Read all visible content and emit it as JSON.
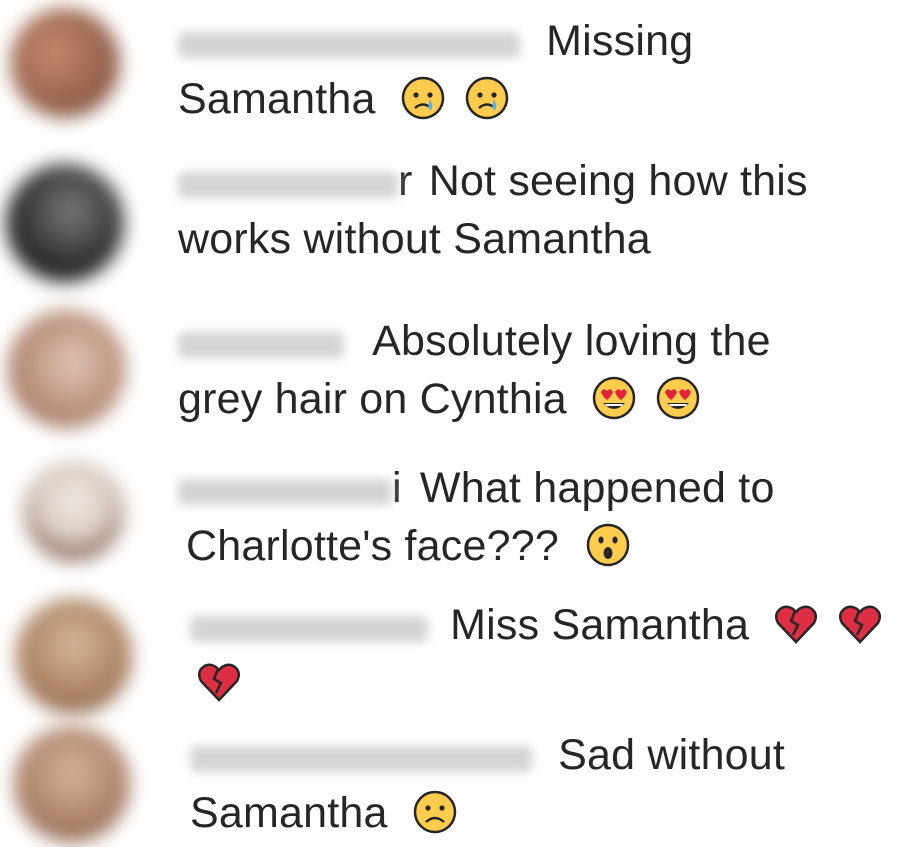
{
  "comments": [
    {
      "username_tail": "",
      "line1": "Missing",
      "line2": "Samantha",
      "emojis_line2": [
        "crying-face",
        "crying-face"
      ],
      "avatar_colors": [
        "#b07a60",
        "#8c5a45"
      ]
    },
    {
      "username_tail": "r",
      "line1": "Not seeing how this",
      "line2": "works without Samantha",
      "emojis_line2": [],
      "avatar_colors": [
        "#6a6a6a",
        "#1c1c1c"
      ]
    },
    {
      "username_tail": "",
      "line1": "Absolutely loving the",
      "line2": "grey hair on Cynthia",
      "emojis_line2": [
        "heart-eyes",
        "heart-eyes"
      ],
      "avatar_colors": [
        "#d9b8a6",
        "#9c6b55"
      ]
    },
    {
      "username_tail": "i",
      "line1": "What happened to",
      "line2": "Charlotte's face???",
      "emojis_line2": [
        "surprised-face"
      ],
      "avatar_colors": [
        "#e8e2dc",
        "#6b4a3a"
      ]
    },
    {
      "username_tail": "",
      "line1": "Miss Samantha",
      "emojis_line1": [
        "broken-heart",
        "broken-heart"
      ],
      "line2": "",
      "emojis_line2": [
        "broken-heart"
      ],
      "avatar_colors": [
        "#c8a58a",
        "#8a6248"
      ]
    },
    {
      "username_tail": "",
      "line1": "Sad without",
      "line2": "Samantha",
      "emojis_line2": [
        "frowning-face"
      ],
      "avatar_colors": [
        "#c9a28a",
        "#9a6f58"
      ]
    }
  ]
}
